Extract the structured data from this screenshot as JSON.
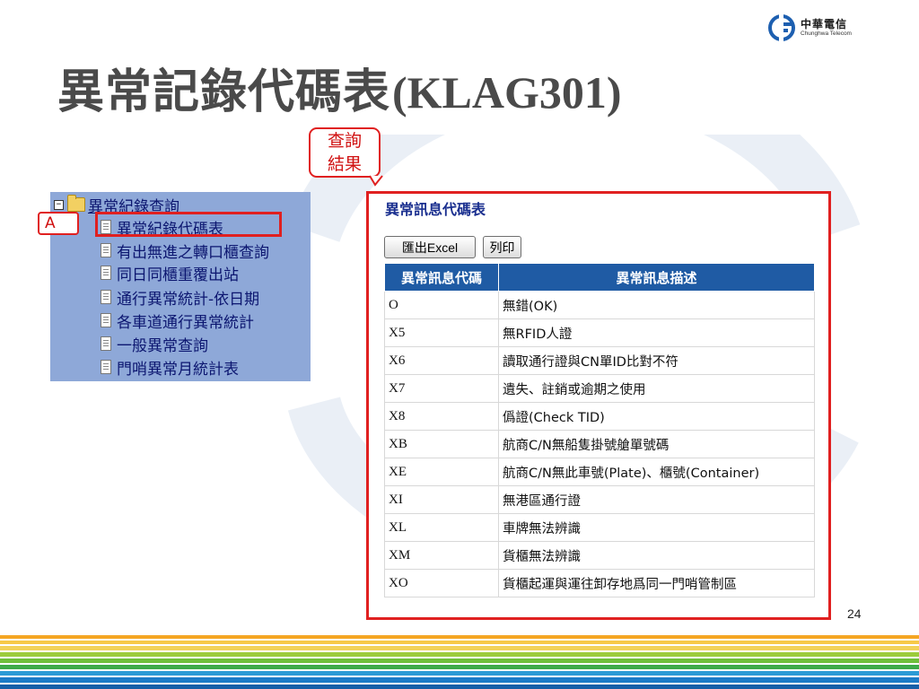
{
  "header": {
    "title_cn": "異常記錄代碼表",
    "title_code": "(KLAG301)",
    "logo_cn": "中華電信",
    "logo_en": "Chunghwa Telecom"
  },
  "callout": {
    "line1": "查詢",
    "line2": "結果"
  },
  "tree": {
    "root": "異常紀錄查詢",
    "items": [
      "異常紀錄代碼表",
      "有出無進之轉口櫃查詢",
      "同日同櫃重覆出站",
      "通行異常統計-依日期",
      "各車道通行異常統計",
      "一般異常查詢",
      "門哨異常月統計表"
    ],
    "label_a": "A"
  },
  "results": {
    "title": "異常訊息代碼表",
    "export_button": "匯出Excel",
    "print_button": "列印",
    "columns": [
      "異常訊息代碼",
      "異常訊息描述"
    ],
    "rows": [
      {
        "code": "O",
        "desc": "無錯(OK)"
      },
      {
        "code": "X5",
        "desc": "無RFID人證"
      },
      {
        "code": "X6",
        "desc": "讀取通行證與CN單ID比對不符"
      },
      {
        "code": "X7",
        "desc": "遺失、註銷或逾期之使用"
      },
      {
        "code": "X8",
        "desc": "僞證(Check TID)"
      },
      {
        "code": "XB",
        "desc": "航商C/N無船隻掛號艙單號碼"
      },
      {
        "code": "XE",
        "desc": "航商C/N無此車號(Plate)、櫃號(Container)"
      },
      {
        "code": "XI",
        "desc": "無港區通行證"
      },
      {
        "code": "XL",
        "desc": "車牌無法辨識"
      },
      {
        "code": "XM",
        "desc": "貨櫃無法辨識"
      },
      {
        "code": "XO",
        "desc": "貨櫃起運與運往卸存地爲同一門哨管制區"
      }
    ]
  },
  "footer": {
    "page_number": "24"
  },
  "colors": {
    "highlight_red": "#e02020",
    "table_header_blue": "#1f5ba4",
    "tree_background": "#8ea8d8",
    "title_gray": "#4a4a4a"
  }
}
